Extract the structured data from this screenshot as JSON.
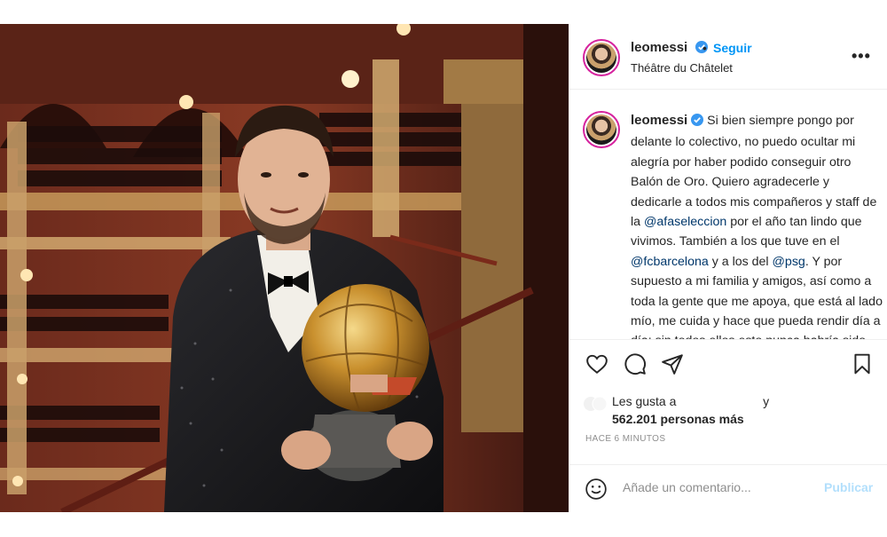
{
  "post": {
    "photo_alt": "",
    "header": {
      "username": "leomessi",
      "follow_label": "Seguir",
      "dot": "•",
      "location": "Théâtre du Châtelet",
      "more_label": "•••"
    },
    "caption": {
      "username": "leomessi",
      "text_1": "Si bien siempre pongo por delante lo colectivo, no puedo ocultar mi alegría por haber podido conseguir otro Balón de Oro. Quiero agradecerle y dedicarle a todos mis compañeros y staff de la ",
      "mention_1": "@afaseleccion",
      "text_2": " por el año tan lindo que vivimos. También a los que tuve en el ",
      "mention_2": "@fcbarcelona",
      "text_3": " y a los del ",
      "mention_3": "@psg",
      "text_4": ". Y por supuesto a mi familia y amigos, así como a toda la gente que me apoya, que está al lado mío, me cuida y hace que pueda rendir día a día: sin todos ellos esto nunca habría sido posible. Y gracias"
    },
    "actions": {
      "like_icon": "heart-icon",
      "comment_icon": "comment-icon",
      "share_icon": "share-icon",
      "save_icon": "bookmark-icon"
    },
    "likes": {
      "prefix": "Les gusta a",
      "conjunction": "y",
      "count": "562.201 personas más"
    },
    "timestamp": "HACE 6 MINUTOS",
    "comment": {
      "emoji_icon": "emoji-icon",
      "placeholder": "Añade un comentario...",
      "publish_label": "Publicar"
    },
    "colors": {
      "link_blue": "#0095f6",
      "mention": "#00376b",
      "publish_disabled": "#b2dffc",
      "muted": "#8e8e8e"
    }
  }
}
